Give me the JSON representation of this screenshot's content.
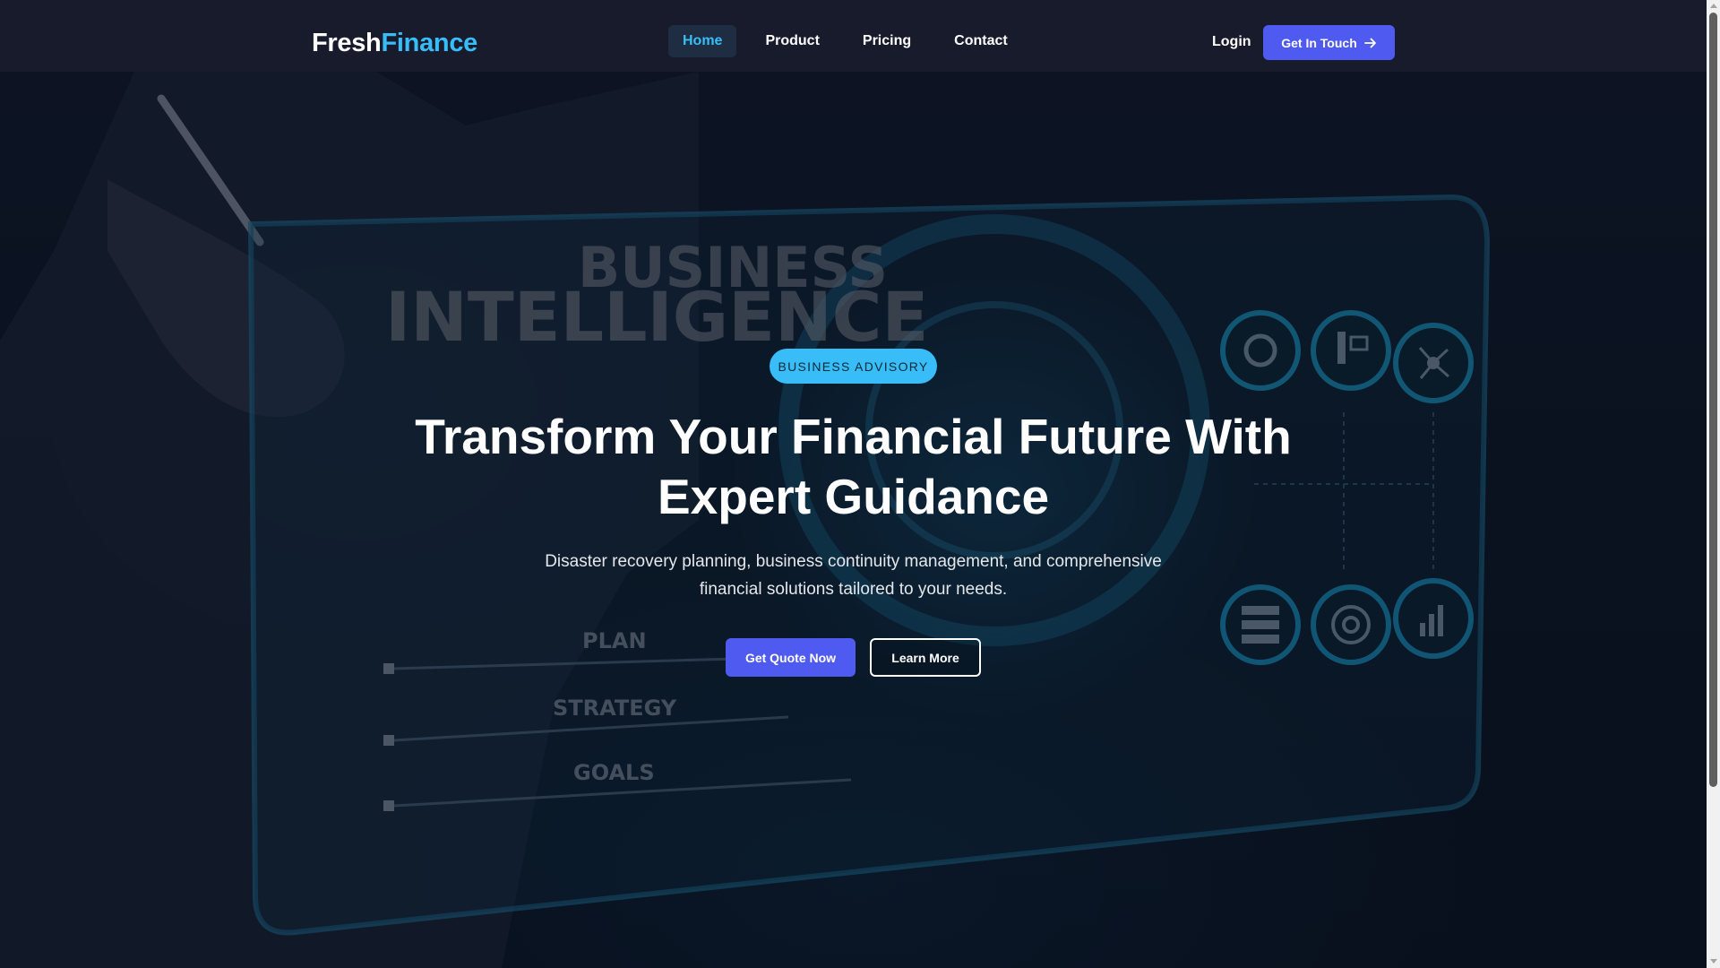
{
  "navbar": {
    "logo": {
      "part1": "Fresh",
      "part2": "Finance"
    },
    "links": [
      {
        "label": "Home",
        "active": true
      },
      {
        "label": "Product",
        "active": false
      },
      {
        "label": "Pricing",
        "active": false
      },
      {
        "label": "Contact",
        "active": false
      }
    ],
    "login_label": "Login",
    "cta_label": "Get In Touch",
    "cta_icon": "arrow-right-icon"
  },
  "hero": {
    "background_image_text": {
      "heading_line1": "BUSINESS",
      "heading_line2": "INTELLIGENCE",
      "list_items": [
        "PLAN",
        "STRATEGY",
        "GOALS"
      ]
    },
    "badge": "BUSINESS ADVISORY",
    "title_line1": "Transform Your Financial Future With",
    "title_line2": "Expert Guidance",
    "subtitle_line1": "Disaster recovery planning, business continuity management, and comprehensive",
    "subtitle_line2": "financial solutions tailored to your needs.",
    "primary_button": "Get Quote Now",
    "secondary_button": "Learn More"
  },
  "colors": {
    "nav_background": "#181b2c",
    "accent": "#38bdf8",
    "primary_button": "#4f5bf0",
    "text": "#ffffff"
  }
}
